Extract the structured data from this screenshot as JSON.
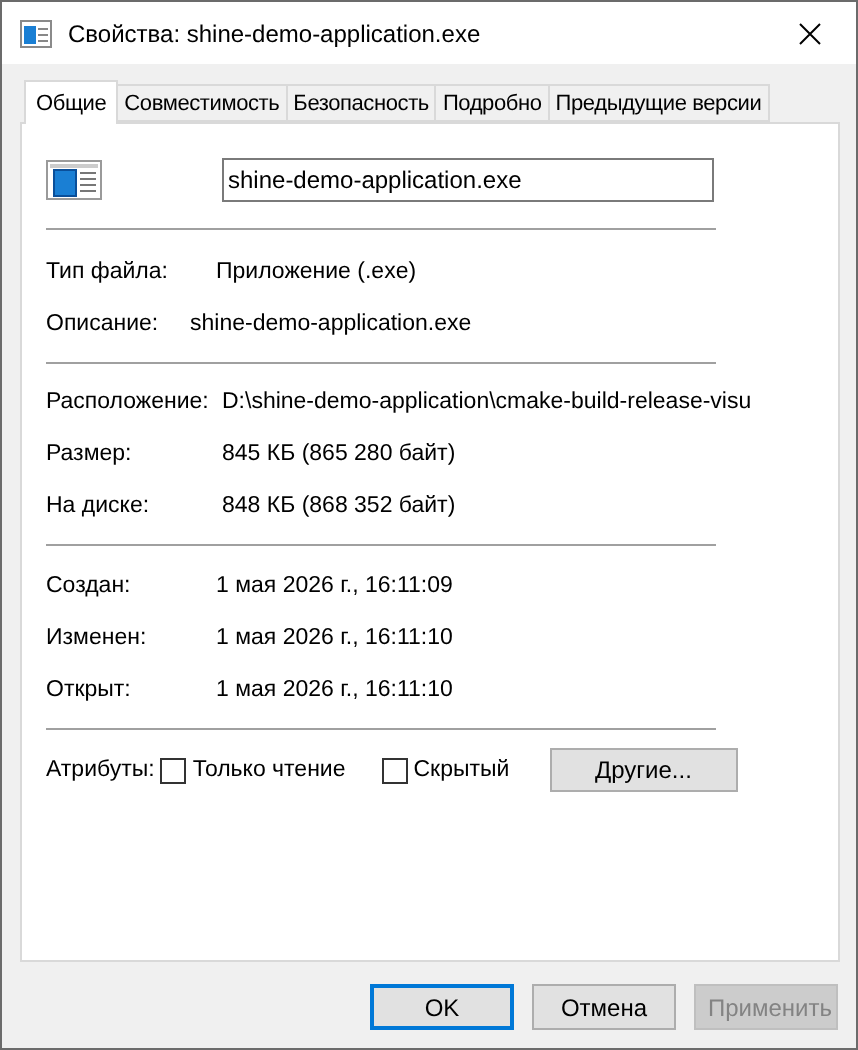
{
  "window": {
    "title": "Свойства: shine-demo-application.exe"
  },
  "tabs": [
    {
      "label": "Общие",
      "selected": true
    },
    {
      "label": "Совместимость",
      "selected": false
    },
    {
      "label": "Безопасность",
      "selected": false
    },
    {
      "label": "Подробно",
      "selected": false
    },
    {
      "label": "Предыдущие версии",
      "selected": false
    }
  ],
  "file_name": {
    "value": "shine-demo-application.exe"
  },
  "file_type": {
    "label": "Тип файла:",
    "value": "Приложение (.exe)"
  },
  "description": {
    "label": "Описание:",
    "value": "shine-demo-application.exe"
  },
  "location_rows": [
    {
      "label": "Расположение:",
      "value": "D:\\shine-demo-application\\cmake-build-release-visu"
    },
    {
      "label": "Размер:",
      "value": "845 КБ (865 280 байт)"
    },
    {
      "label": "На диске:",
      "value": "848 КБ (868 352 байт)"
    }
  ],
  "date_rows": [
    {
      "label": "Создан:",
      "value": "1 мая 2026 г., 16:11:09"
    },
    {
      "label": "Изменен:",
      "value": "1 мая 2026 г., 16:11:10"
    },
    {
      "label": "Открыт:",
      "value": "1 мая 2026 г., 16:11:10"
    }
  ],
  "attributes": {
    "label": "Атрибуты:",
    "checkboxes": [
      {
        "label": "Только чтение",
        "checked": false
      },
      {
        "label": "Скрытый",
        "checked": false
      }
    ],
    "other_button": "Другие..."
  },
  "buttons": [
    {
      "label": "OK",
      "default": true,
      "disabled": false
    },
    {
      "label": "Отмена",
      "default": false,
      "disabled": false
    },
    {
      "label": "Применить",
      "default": false,
      "disabled": true
    }
  ]
}
